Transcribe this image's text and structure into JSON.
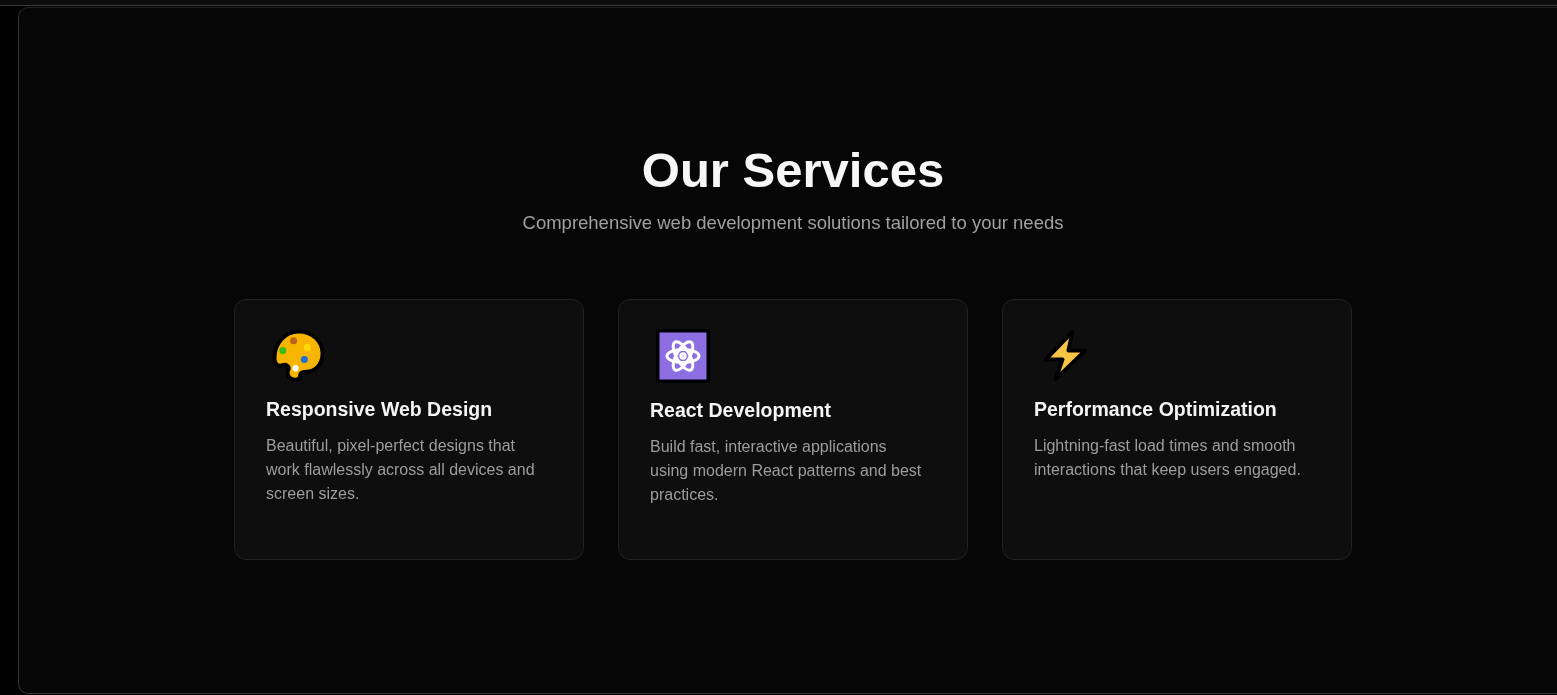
{
  "header": {
    "title": "Our Services",
    "subtitle": "Comprehensive web development solutions tailored to your needs"
  },
  "services": [
    {
      "kind": "palette",
      "title": "Responsive Web Design",
      "description": "Beautiful, pixel-perfect designs that work flawlessly across all devices and screen sizes."
    },
    {
      "kind": "atom",
      "title": "React Development",
      "description": "Build fast, interactive applications using modern React patterns and best practices."
    },
    {
      "kind": "lightning",
      "title": "Performance Optimization",
      "description": "Lightning-fast load times and smooth interactions that keep users engaged."
    }
  ]
}
